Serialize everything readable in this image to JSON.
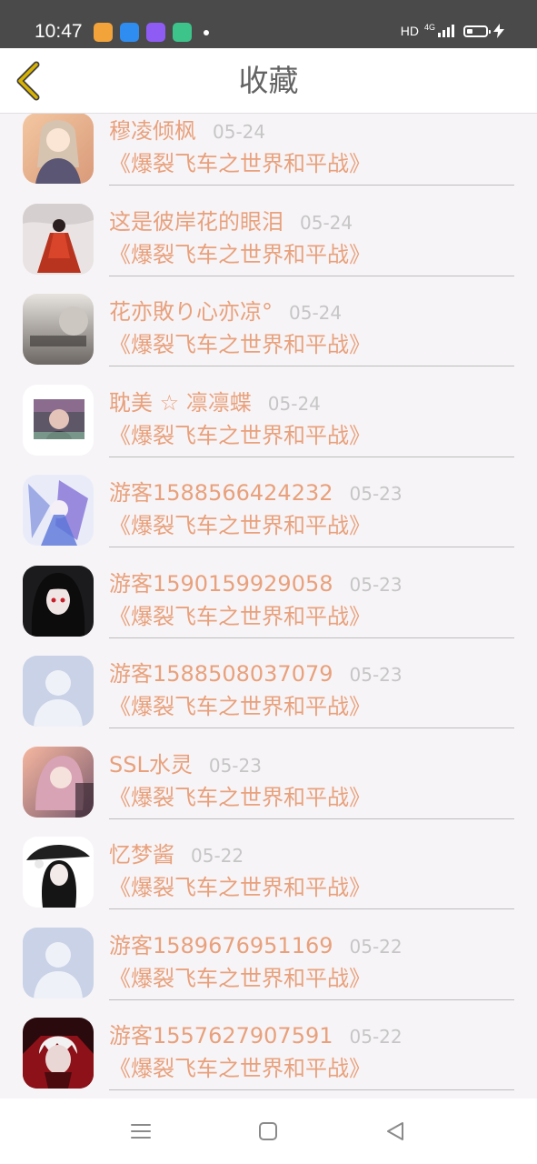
{
  "status_bar": {
    "time": "10:47",
    "network": "HD",
    "network_type": "4G",
    "battery_level": 0.3,
    "app_icons": [
      {
        "name": "wallet-app-icon",
        "color": "#f2a33a"
      },
      {
        "name": "browser-app-icon",
        "color": "#2f8cf0"
      },
      {
        "name": "assistant-app-icon",
        "color": "#8e5cf5"
      },
      {
        "name": "notes-app-icon",
        "color": "#3cc48a"
      }
    ]
  },
  "header": {
    "title": "收藏",
    "back_icon": "chevron-left-icon",
    "accent_color": "#d9b300"
  },
  "items": [
    {
      "name": "穆凌倾枫",
      "date": "05-24",
      "book": "《爆裂飞车之世界和平战》",
      "avatar": "anime-girl-avatar"
    },
    {
      "name": "这是彼岸花的眼泪",
      "date": "05-24",
      "book": "《爆裂飞车之世界和平战》",
      "avatar": "red-dress-avatar"
    },
    {
      "name": "花亦敗り心亦凉°",
      "date": "05-24",
      "book": "《爆裂飞车之世界和平战》",
      "avatar": "gray-photo-avatar"
    },
    {
      "name": "耽美 ☆ 凛凛蝶",
      "date": "05-24",
      "book": "《爆裂飞车之世界和平战》",
      "avatar": "photo-girl-avatar"
    },
    {
      "name": "游客1588566424232",
      "date": "05-23",
      "book": "《爆裂飞车之世界和平战》",
      "avatar": "blue-anime-avatar"
    },
    {
      "name": "游客1590159929058",
      "date": "05-23",
      "book": "《爆裂飞车之世界和平战》",
      "avatar": "dark-hair-avatar"
    },
    {
      "name": "游客1588508037079",
      "date": "05-23",
      "book": "《爆裂飞车之世界和平战》",
      "avatar": "default-user-avatar"
    },
    {
      "name": "SSL水灵",
      "date": "05-23",
      "book": "《爆裂飞车之世界和平战》",
      "avatar": "pink-anime-avatar"
    },
    {
      "name": "忆梦酱",
      "date": "05-22",
      "book": "《爆裂飞车之世界和平战》",
      "avatar": "umbrella-girl-avatar"
    },
    {
      "name": "游客1589676951169",
      "date": "05-22",
      "book": "《爆裂飞车之世界和平战》",
      "avatar": "default-user-avatar"
    },
    {
      "name": "游客1557627907591",
      "date": "05-22",
      "book": "《爆裂飞车之世界和平战》",
      "avatar": "white-hair-avatar"
    }
  ],
  "nav_bar": {
    "menu_icon": "menu-icon",
    "home_icon": "home-square-icon",
    "back_icon": "back-triangle-icon"
  }
}
